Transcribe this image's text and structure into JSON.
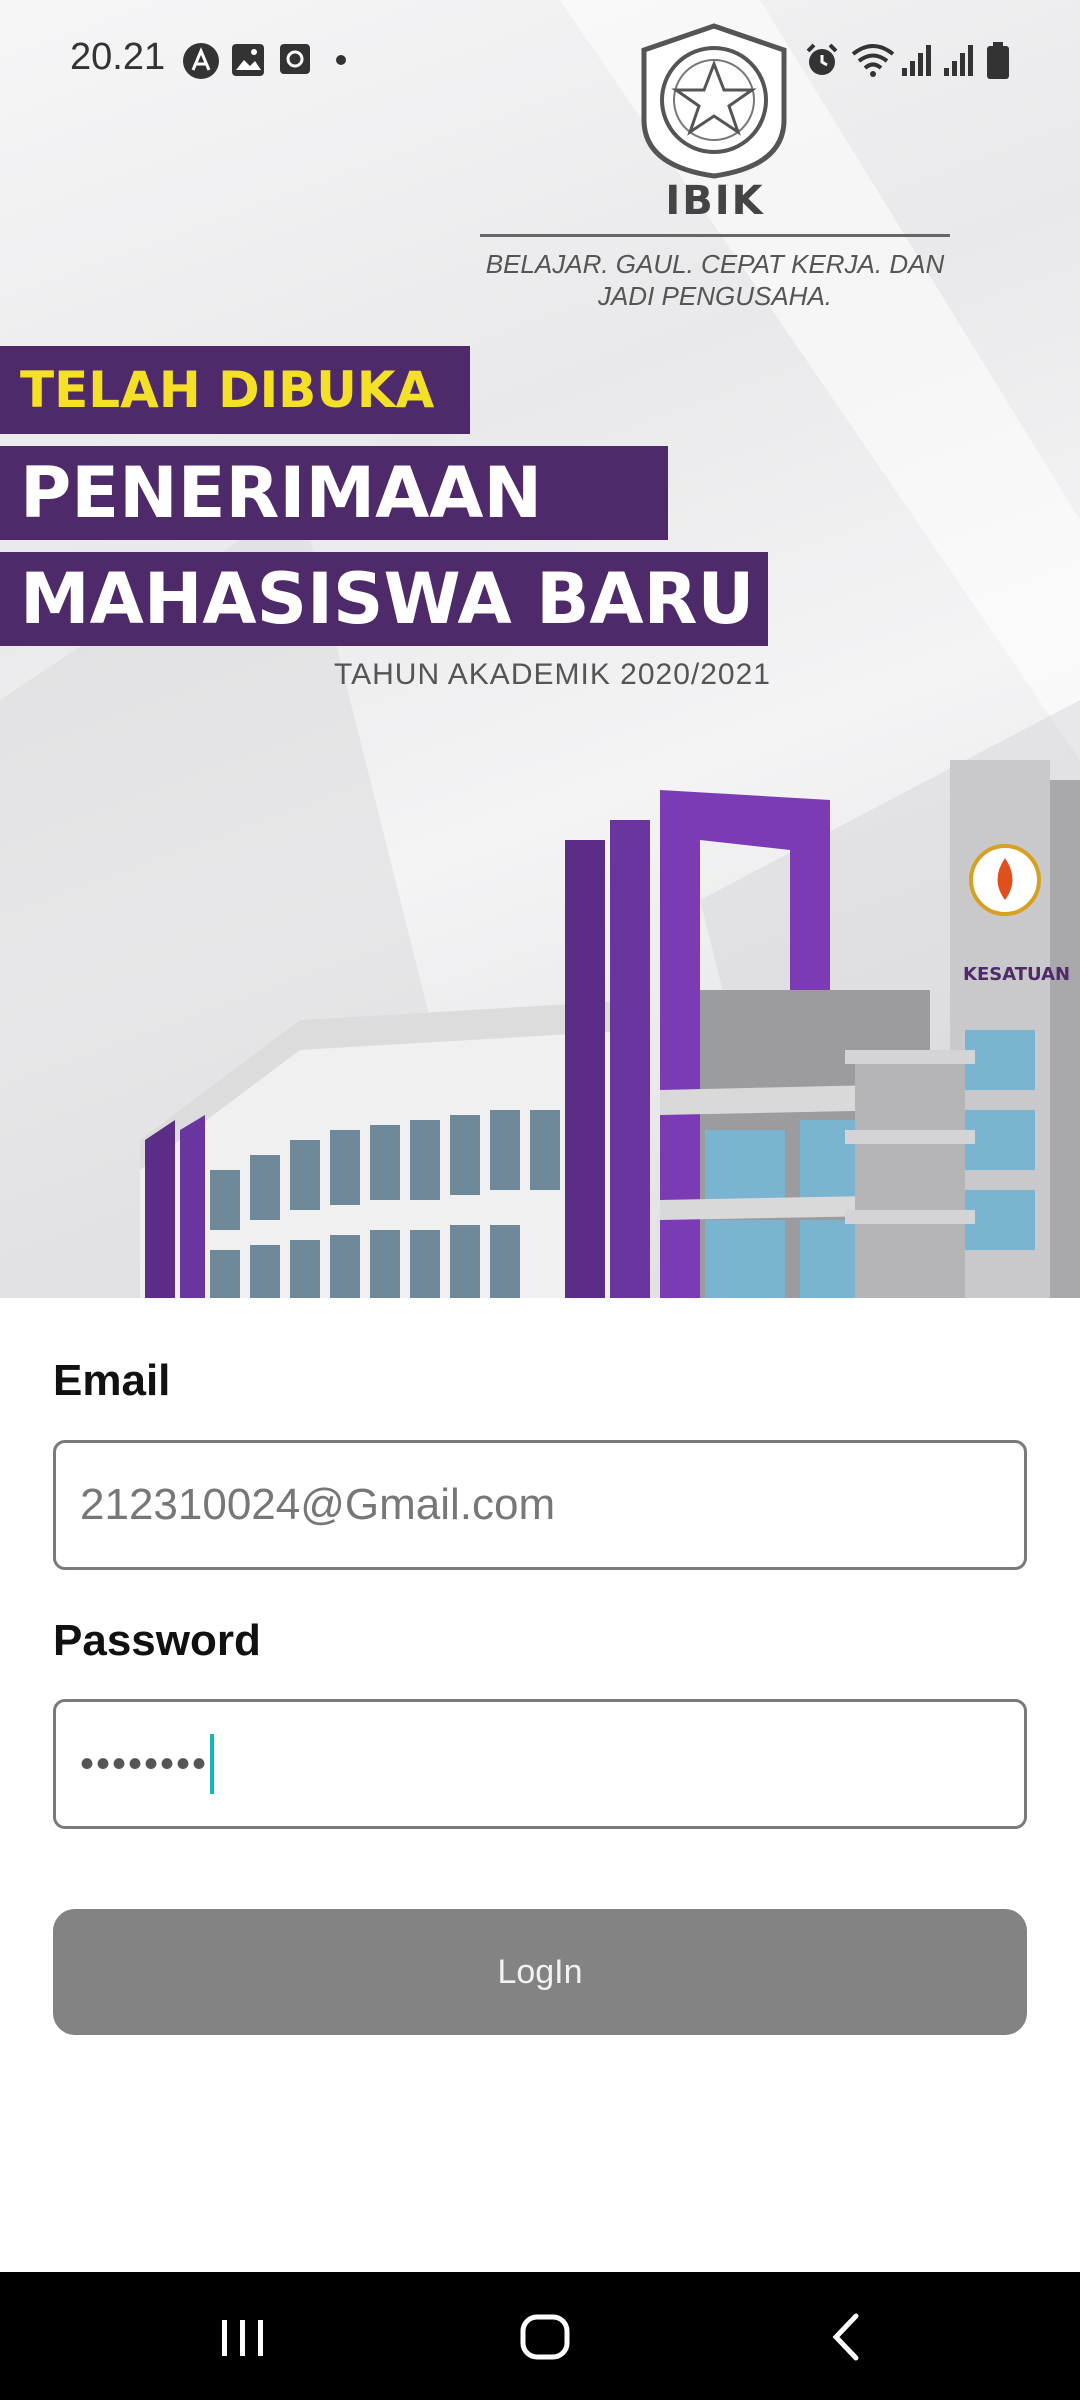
{
  "status_bar": {
    "time": "20.21",
    "left_icons": [
      "app-a-icon",
      "image-icon",
      "screenshot-icon",
      "dot-icon"
    ],
    "right_icons": [
      "alarm-icon",
      "wifi-icon",
      "signal-1-icon",
      "signal-2-icon",
      "battery-icon"
    ]
  },
  "banner": {
    "logo_name": "IBIK",
    "tagline": "BELAJAR. GAUL. CEPAT KERJA. DAN JADI PENGUSAHA.",
    "open_label": "TELAH DIBUKA",
    "headline_line1": "PENERIMAAN",
    "headline_line2": "MAHASISWA BARU",
    "year_label": "TAHUN AKADEMIK 2020/2021",
    "building_sign": "KESATUAN",
    "accent_color": "#4e2a6a",
    "highlight_color": "#f5e028"
  },
  "form": {
    "email_label": "Email",
    "email_value": "212310024@Gmail.com",
    "password_label": "Password",
    "password_mask": "••••••••",
    "login_label": "LogIn"
  },
  "nav": {
    "icons": [
      "recent-apps-icon",
      "home-icon",
      "back-icon"
    ]
  }
}
